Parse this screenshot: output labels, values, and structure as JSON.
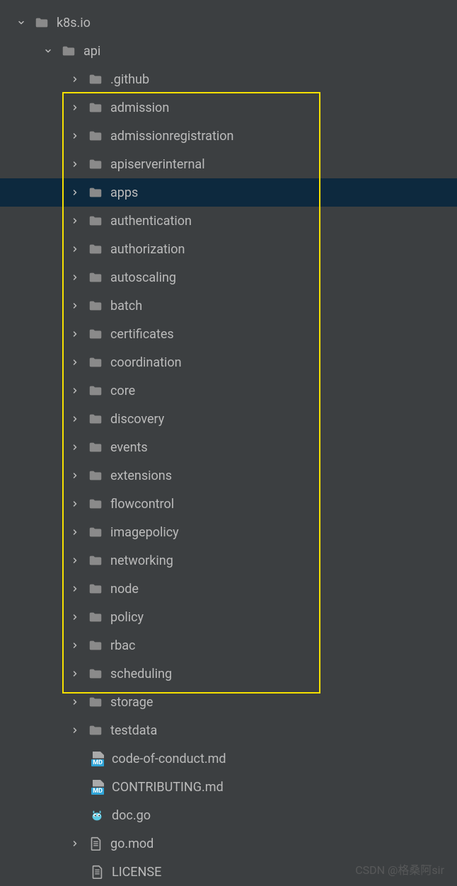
{
  "tree": {
    "root": {
      "label": "k8s.io",
      "expanded": true,
      "type": "folder"
    },
    "api": {
      "label": "api",
      "expanded": true,
      "type": "folder"
    },
    "children": [
      {
        "label": ".github",
        "type": "folder",
        "expanded": false,
        "highlight": false,
        "selected": false
      },
      {
        "label": "admission",
        "type": "folder",
        "expanded": false,
        "highlight": true,
        "selected": false
      },
      {
        "label": "admissionregistration",
        "type": "folder",
        "expanded": false,
        "highlight": true,
        "selected": false
      },
      {
        "label": "apiserverinternal",
        "type": "folder",
        "expanded": false,
        "highlight": true,
        "selected": false
      },
      {
        "label": "apps",
        "type": "folder",
        "expanded": false,
        "highlight": true,
        "selected": true
      },
      {
        "label": "authentication",
        "type": "folder",
        "expanded": false,
        "highlight": true,
        "selected": false
      },
      {
        "label": "authorization",
        "type": "folder",
        "expanded": false,
        "highlight": true,
        "selected": false
      },
      {
        "label": "autoscaling",
        "type": "folder",
        "expanded": false,
        "highlight": true,
        "selected": false
      },
      {
        "label": "batch",
        "type": "folder",
        "expanded": false,
        "highlight": true,
        "selected": false
      },
      {
        "label": "certificates",
        "type": "folder",
        "expanded": false,
        "highlight": true,
        "selected": false
      },
      {
        "label": "coordination",
        "type": "folder",
        "expanded": false,
        "highlight": true,
        "selected": false
      },
      {
        "label": "core",
        "type": "folder",
        "expanded": false,
        "highlight": true,
        "selected": false
      },
      {
        "label": "discovery",
        "type": "folder",
        "expanded": false,
        "highlight": true,
        "selected": false
      },
      {
        "label": "events",
        "type": "folder",
        "expanded": false,
        "highlight": true,
        "selected": false
      },
      {
        "label": "extensions",
        "type": "folder",
        "expanded": false,
        "highlight": true,
        "selected": false
      },
      {
        "label": "flowcontrol",
        "type": "folder",
        "expanded": false,
        "highlight": true,
        "selected": false
      },
      {
        "label": "imagepolicy",
        "type": "folder",
        "expanded": false,
        "highlight": true,
        "selected": false
      },
      {
        "label": "networking",
        "type": "folder",
        "expanded": false,
        "highlight": true,
        "selected": false
      },
      {
        "label": "node",
        "type": "folder",
        "expanded": false,
        "highlight": true,
        "selected": false
      },
      {
        "label": "policy",
        "type": "folder",
        "expanded": false,
        "highlight": true,
        "selected": false
      },
      {
        "label": "rbac",
        "type": "folder",
        "expanded": false,
        "highlight": true,
        "selected": false
      },
      {
        "label": "scheduling",
        "type": "folder",
        "expanded": false,
        "highlight": true,
        "selected": false
      },
      {
        "label": "storage",
        "type": "folder",
        "expanded": false,
        "highlight": true,
        "selected": false
      },
      {
        "label": "testdata",
        "type": "folder",
        "expanded": false,
        "highlight": false,
        "selected": false
      },
      {
        "label": "code-of-conduct.md",
        "type": "md",
        "expanded": null,
        "highlight": false,
        "selected": false
      },
      {
        "label": "CONTRIBUTING.md",
        "type": "md",
        "expanded": null,
        "highlight": false,
        "selected": false
      },
      {
        "label": "doc.go",
        "type": "go",
        "expanded": null,
        "highlight": false,
        "selected": false
      },
      {
        "label": "go.mod",
        "type": "file",
        "expanded": false,
        "highlight": false,
        "selected": false
      },
      {
        "label": "LICENSE",
        "type": "file",
        "expanded": null,
        "highlight": false,
        "selected": false
      }
    ]
  },
  "watermark": "CSDN @格桑阿sir"
}
